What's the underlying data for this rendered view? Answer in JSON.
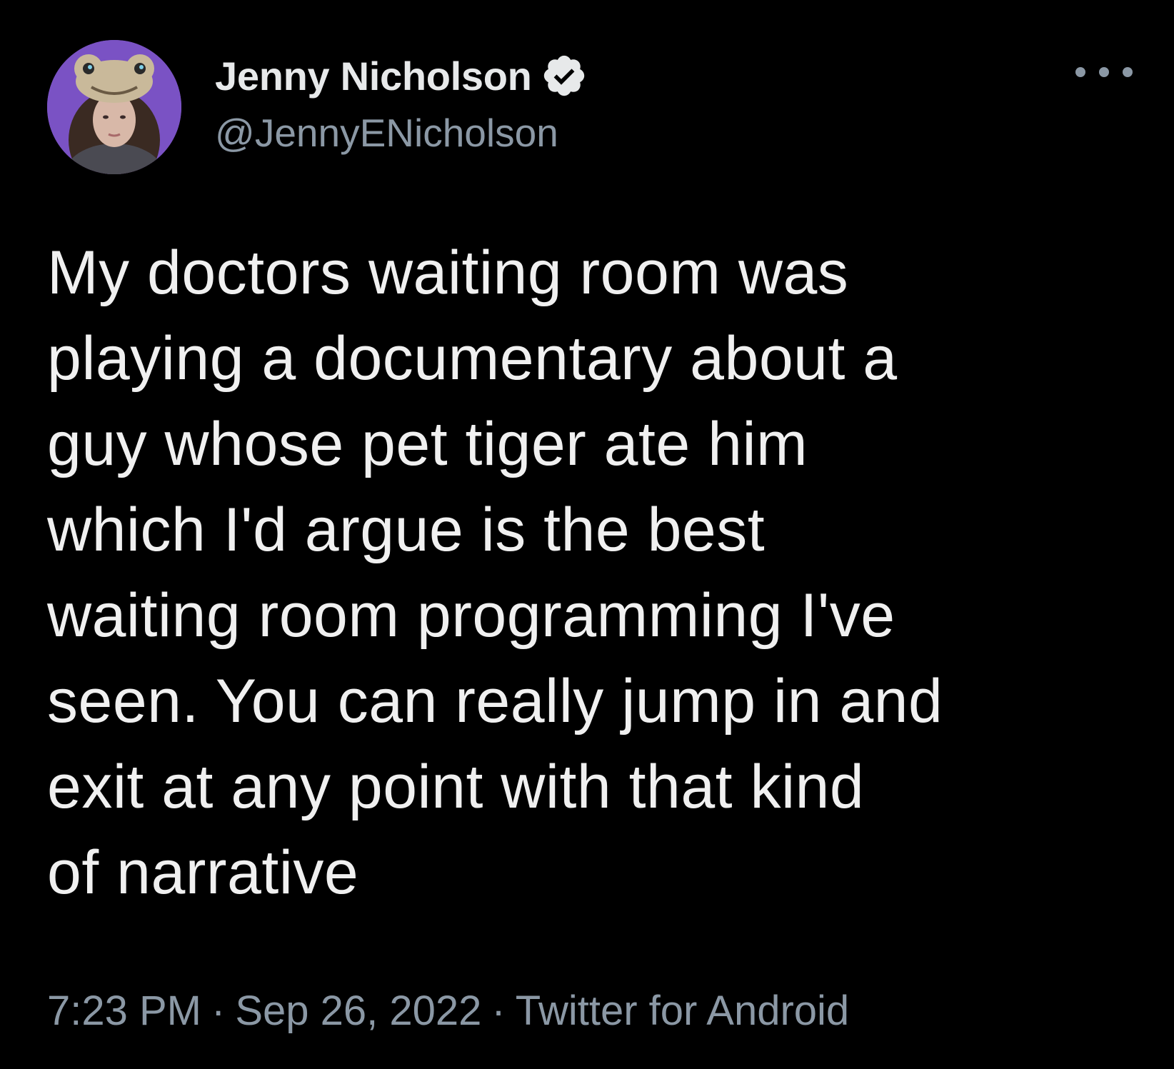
{
  "author": {
    "display_name": "Jenny Nicholson",
    "handle": "@JennyENicholson",
    "verified": true,
    "avatar_icon": "profile-photo"
  },
  "tweet": {
    "text_lines": [
      "My doctors waiting room was",
      "playing a documentary about a",
      "guy whose pet tiger ate him",
      "which I'd argue is the best",
      "waiting room programming I've",
      "seen. You can really jump in and",
      "exit at any point with that kind",
      "of narrative"
    ]
  },
  "meta": {
    "time": "7:23 PM",
    "date": "Sep 26, 2022",
    "source": "Twitter for Android",
    "separator": "·"
  },
  "icons": {
    "more": "more-horizontal-icon",
    "verified": "verified-badge-icon"
  },
  "colors": {
    "background": "#000000",
    "primary_text": "#e7e9ea",
    "secondary_text": "#8b98a5"
  }
}
